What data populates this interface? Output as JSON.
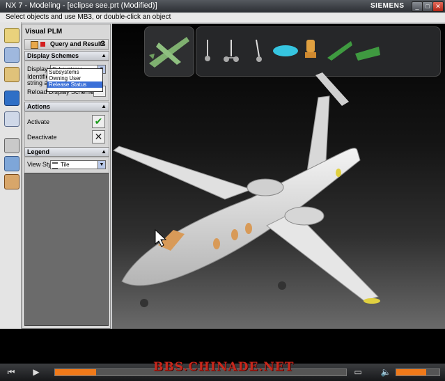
{
  "window": {
    "title": "NX 7 - Modeling - [eclipse see.prt (Modified)]",
    "brand": "SIEMENS",
    "min_icon": "minimize-icon",
    "max_icon": "maximize-icon",
    "close_icon": "close-icon"
  },
  "cue_line": "Select objects and use MB3, or double-click an object",
  "navigator": {
    "title": "Visual PLM",
    "tab_label": "Query and Results",
    "help": "?",
    "display_schemes": {
      "header": "Display Schemes",
      "display_label": "Display Sc",
      "display_value": "Subsystems",
      "identify_label": "Identifies",
      "string_attr_label": "string attri",
      "reload_label": "Reload Display Scheme",
      "dropdown_options": [
        "Subsystems",
        "Owning User",
        "Release Status"
      ],
      "dropdown_selected": "Release Status"
    },
    "actions": {
      "header": "Actions",
      "activate": "Activate",
      "deactivate": "Deactivate"
    },
    "legend": {
      "header": "Legend",
      "view_style_label": "View Style",
      "view_style_value": "Tile"
    }
  },
  "viewport": {
    "thumbnails": [
      "aircraft",
      "landing-gear-1",
      "landing-gear-2",
      "landing-gear-3",
      "fuel-tank",
      "seat",
      "wing-structure",
      "tail-structure"
    ]
  },
  "player": {
    "progress_fraction": 0.14,
    "volume_fraction": 0.7,
    "watermark": "BBS.CHINADE.NET"
  },
  "colors": {
    "accent": "#f07a1a",
    "selection": "#3a6fd8",
    "title_bg": "#3d4046"
  }
}
